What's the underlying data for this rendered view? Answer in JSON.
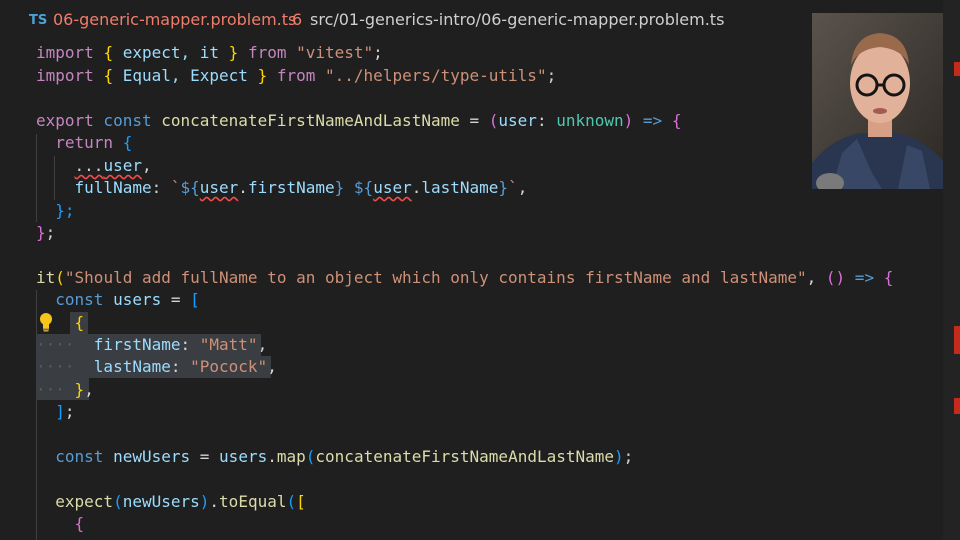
{
  "tab": {
    "language_badge": "TS",
    "filename": "06-generic-mapper.problem.ts",
    "problem_count": "6",
    "path": "src/01-generics-intro/06-generic-mapper.problem.ts"
  },
  "code": {
    "l1": {
      "kw_import": "import",
      "open": "{",
      "names": " expect, it ",
      "close": "}",
      "kw_from": " from ",
      "str": "\"vitest\"",
      "semi": ";"
    },
    "l2": {
      "kw_import": "import",
      "open": "{",
      "names": " Equal, Expect ",
      "close": "}",
      "kw_from": " from ",
      "str": "\"../helpers/type-utils\"",
      "semi": ";"
    },
    "l4": {
      "kw_export": "export",
      "kw_const": " const ",
      "fn": "concatenateFirstNameAndLastName",
      "eq": " = ",
      "open": "(",
      "param": "user",
      "colon": ": ",
      "type": "unknown",
      "close": ")",
      "arrow": " => ",
      "brace": "{"
    },
    "l5": {
      "kw_return": "return",
      "brace": " {"
    },
    "l6": {
      "spread": "...",
      "var": "user",
      "comma": ","
    },
    "l7": {
      "prop": "fullName",
      "colon": ": ",
      "tick": "`",
      "i1": "${",
      "v1": "user",
      "d1": ".",
      "p1": "firstName",
      "c1": "}",
      "sp": " ",
      "i2": "${",
      "v2": "user",
      "d2": ".",
      "p2": "lastName",
      "c2": "}",
      "tick2": "`",
      "comma": ","
    },
    "l8": {
      "close": "};"
    },
    "l9": {
      "close": "}",
      "semi": ";"
    },
    "l11": {
      "it": "it",
      "open": "(",
      "str": "\"Should add fullName to an object which only contains firstName and lastName\"",
      "comma": ", ",
      "popen": "()",
      "arrow": " => ",
      "brace": "{"
    },
    "l12": {
      "kw_const": "const",
      "var": " users",
      "eq": " = ",
      "open": "["
    },
    "l13": {
      "brace": "{"
    },
    "l14": {
      "ws": "····",
      "prop": "firstName",
      "colon": ": ",
      "str": "\"Matt\"",
      "comma": ","
    },
    "l15": {
      "ws": "····",
      "prop": "lastName",
      "colon": ": ",
      "str": "\"Pocock\"",
      "comma": ","
    },
    "l16": {
      "ws": "···",
      "close": "}",
      "comma": ","
    },
    "l17": {
      "close": "]",
      "semi": ";"
    },
    "l19": {
      "kw_const": "const",
      "var": " newUsers",
      "eq": " = ",
      "obj": "users",
      "dot": ".",
      "method": "map",
      "open": "(",
      "arg": "concatenateFirstNameAndLastName",
      "close": ")",
      "semi": ";"
    },
    "l21": {
      "fn": "expect",
      "open": "(",
      "arg": "newUsers",
      "close": ")",
      "dot": ".",
      "method": "toEqual",
      "open2": "(",
      "bracket": "["
    },
    "l22": {
      "brace": "{"
    }
  },
  "icons": {
    "lightbulb": "lightbulb-icon"
  },
  "colors": {
    "background": "#1f1f1f",
    "error": "#f14c4c",
    "tab_filename": "#f07d6b"
  }
}
